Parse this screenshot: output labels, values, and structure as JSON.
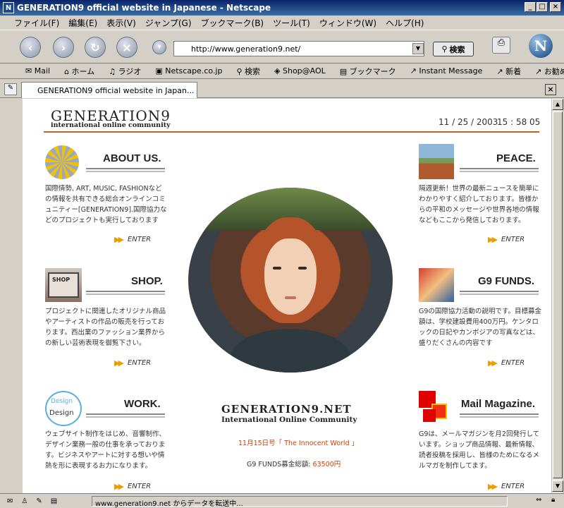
{
  "window": {
    "title": "GENERATION9 official website in Japanese - Netscape"
  },
  "menu": [
    "ファイル(F)",
    "編集(E)",
    "表示(V)",
    "ジャンプ(G)",
    "ブックマーク(B)",
    "ツール(T)",
    "ウィンドウ(W)",
    "ヘルプ(H)"
  ],
  "nav": {
    "url": "http://www.generation9.net/",
    "search_label": "検索"
  },
  "personal_toolbar": [
    "Mail",
    "ホーム",
    "ラジオ",
    "Netscape.co.jp",
    "検索",
    "Shop@AOL",
    "ブックマーク",
    "Instant Message",
    "新着",
    "お勧め"
  ],
  "tab": {
    "label": "GENERATION9 official website in Japan..."
  },
  "page": {
    "logo": "GENERATION9",
    "logo_sub": "international online community",
    "date": "11 / 25 / 2003",
    "time": "15 : 58 05",
    "center_title": "GENERATION9.NET",
    "center_sub": "International Online Community",
    "news": "11月15日号「 The Innocent World 」",
    "funds_label": "G9 FUNDS募金総額: ",
    "funds_value": "63500円",
    "enter": "ENTER",
    "sections": {
      "about": {
        "title": "ABOUT US.",
        "text": "国際情勢, ART, MUSIC, FASHIONなどの情報を共有できる総合オンラインコミュニティー[GENERATION9].国際協力などのプロジェクトも実行しております"
      },
      "shop": {
        "title": "SHOP.",
        "img_text": "SHOP",
        "text": "プロジェクトに関連したオリジナル商品やアーティストの作品の販売を行っております。西出業のファッション業界からの新しい芸術表現を御覧下さい。"
      },
      "work": {
        "title": "WORK.",
        "img_text1": "Design",
        "img_text2": "Design",
        "text": "ウェブサイト制作をはじめ、音響制作、デザイン業務一般の仕事を承っております。ビジネスやアートに対する想いや情熱を形に表現するお力になります。"
      },
      "peace": {
        "title": "PEACE.",
        "text": "隔週更新！世界の最新ニュースを簡単にわかりやすく紹介しております。皆様からの平和のメッセージや世界各地の情報などもここから発信しております。"
      },
      "funds": {
        "title": "G9 FUNDS.",
        "text": "G9の国際協力活動の説明です。目標募金額は、学校建設費用400万円。ケンタロックの日記やカンボジアの写真などは、盛りだくさんの内容です"
      },
      "mail": {
        "title": "Mail Magazine.",
        "text": "G9は、メールマガジンを月2回発行しています。ショップ商品情報、最新情報、読者投稿を採用し、皆様のためになるメルマガを制作してます。"
      }
    }
  },
  "status": {
    "text": "www.generation9.net からデータを転送中..."
  }
}
